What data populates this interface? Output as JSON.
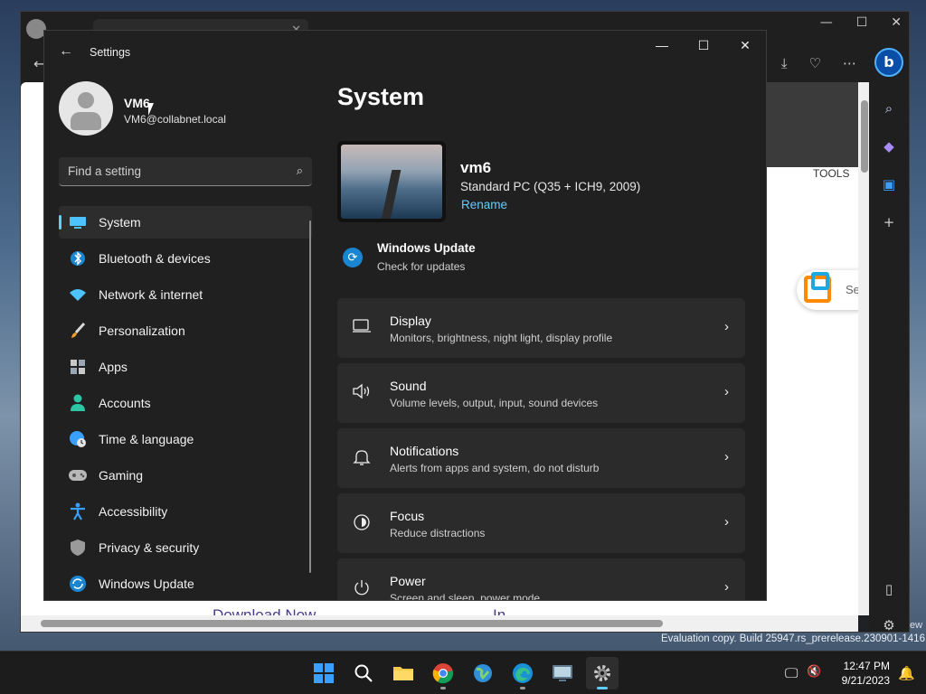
{
  "settings": {
    "window_title": "Settings",
    "profile": {
      "name": "VM6",
      "email": "VM6@collabnet.local"
    },
    "search": {
      "placeholder": "Find a setting"
    },
    "nav": [
      {
        "label": "System",
        "icon": "monitor-icon"
      },
      {
        "label": "Bluetooth & devices",
        "icon": "bluetooth-icon"
      },
      {
        "label": "Network & internet",
        "icon": "wifi-icon"
      },
      {
        "label": "Personalization",
        "icon": "brush-icon"
      },
      {
        "label": "Apps",
        "icon": "apps-icon"
      },
      {
        "label": "Accounts",
        "icon": "person-icon"
      },
      {
        "label": "Time & language",
        "icon": "globe-clock-icon"
      },
      {
        "label": "Gaming",
        "icon": "gamepad-icon"
      },
      {
        "label": "Accessibility",
        "icon": "accessibility-icon"
      },
      {
        "label": "Privacy & security",
        "icon": "shield-icon"
      },
      {
        "label": "Windows Update",
        "icon": "update-icon"
      }
    ],
    "main": {
      "title": "System",
      "device": {
        "name": "vm6",
        "spec": "Standard PC (Q35 + ICH9, 2009)",
        "rename": "Rename"
      },
      "windows_update": {
        "title": "Windows Update",
        "subtitle": "Check for updates"
      },
      "cards": [
        {
          "title": "Display",
          "subtitle": "Monitors, brightness, night light, display profile",
          "icon": "display-icon"
        },
        {
          "title": "Sound",
          "subtitle": "Volume levels, output, input, sound devices",
          "icon": "speaker-icon"
        },
        {
          "title": "Notifications",
          "subtitle": "Alerts from apps and system, do not disturb",
          "icon": "bell-icon"
        },
        {
          "title": "Focus",
          "subtitle": "Reduce distractions",
          "icon": "focus-icon"
        },
        {
          "title": "Power",
          "subtitle": "Screen and sleep, power mode",
          "icon": "power-icon"
        }
      ]
    }
  },
  "browser": {
    "tools_label": "TOOLS",
    "promo_text": "Se",
    "download_text": "Download Now",
    "in_text": "In"
  },
  "desktop": {
    "evaluation_text": "Evaluation copy. Build 25947.rs_prerelease.230901-1416",
    "edge_text": "ew"
  },
  "taskbar": {
    "time": "12:47 PM",
    "date": "9/21/2023"
  },
  "colors": {
    "accent": "#60cdff",
    "window_bg": "#202020",
    "card_bg": "#2b2b2b"
  }
}
